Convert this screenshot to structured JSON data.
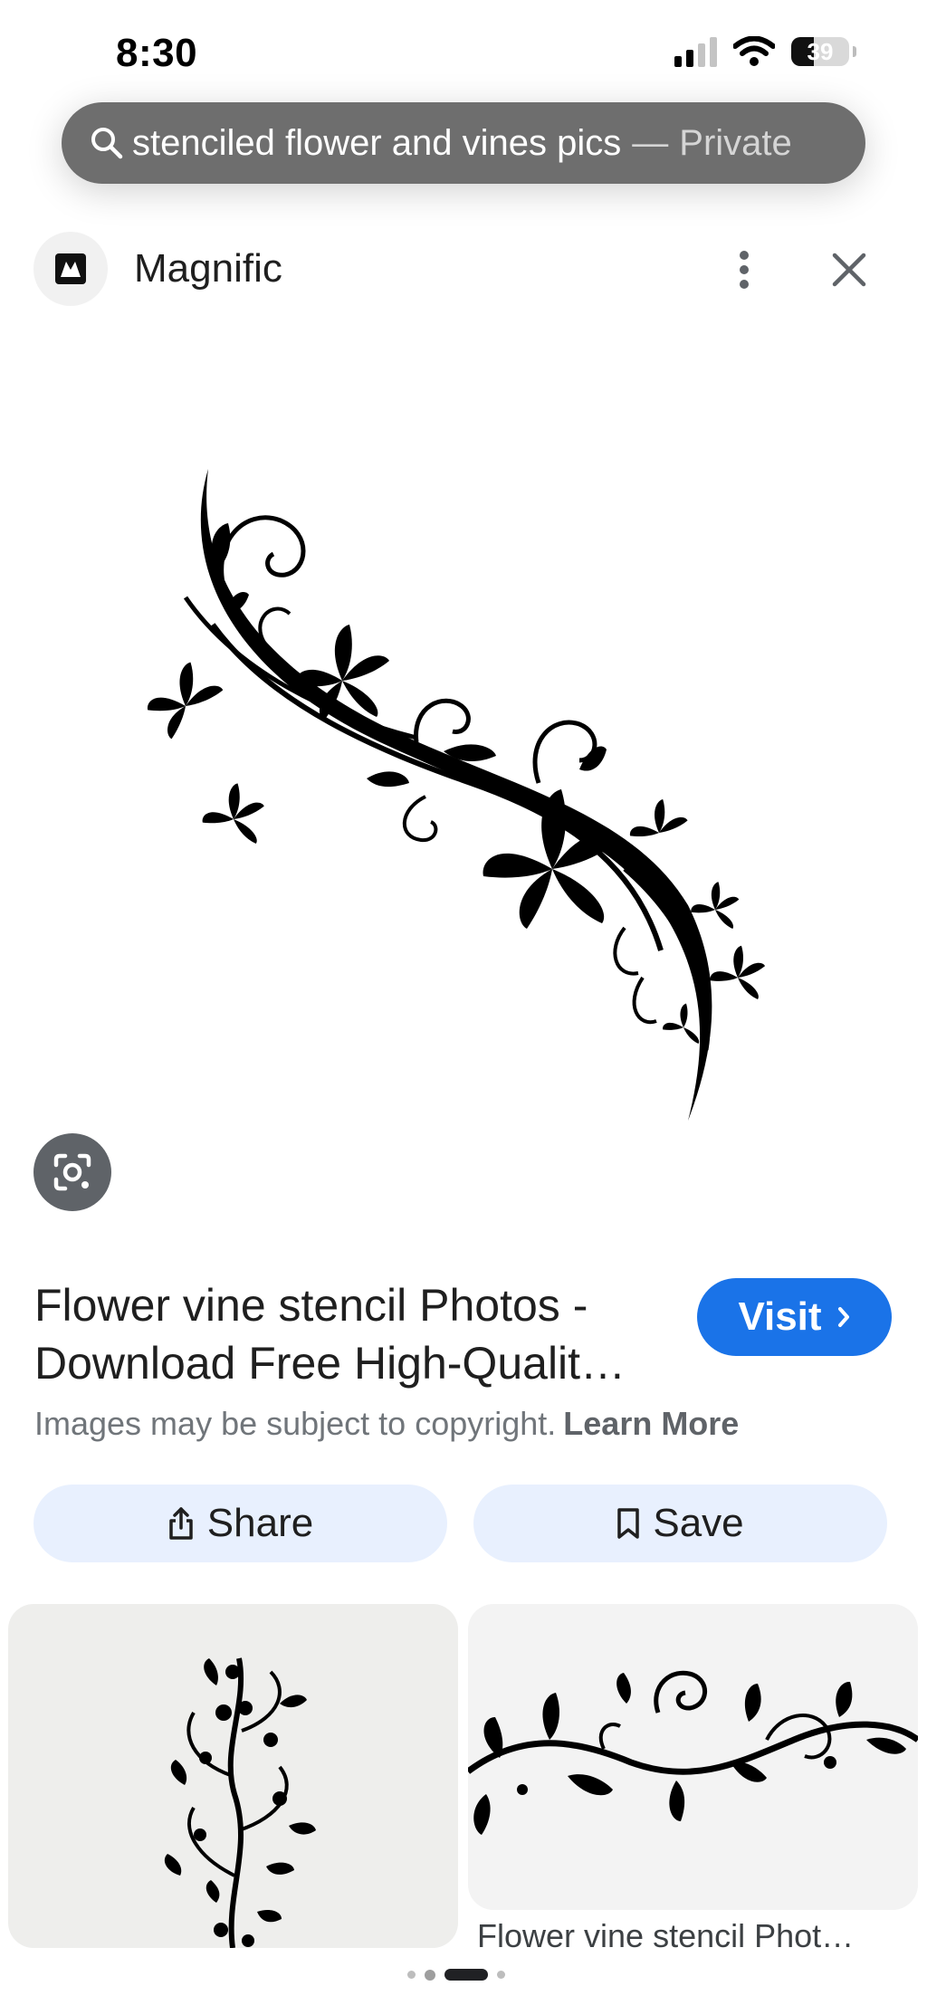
{
  "status_bar": {
    "time": "8:30",
    "battery_percent": "39",
    "battery_level": 0.39
  },
  "search": {
    "query": "stenciled flower and vines pics",
    "separator": "—",
    "mode": "Private"
  },
  "source": {
    "name": "Magnific",
    "icons": {
      "favicon": "magnific-logo",
      "more": "more-vertical-icon",
      "close": "close-icon"
    }
  },
  "result": {
    "title_line1": "Flower vine stencil Photos -",
    "title_line2": "Download Free High-Qualit…",
    "visit_label": "Visit",
    "copyright_text": "Images may be subject to copyright.",
    "learn_more": "Learn More",
    "share_label": "Share",
    "save_label": "Save"
  },
  "related": {
    "items": [
      {
        "caption": ""
      },
      {
        "caption": "Flower vine stencil Phot…"
      }
    ]
  },
  "colors": {
    "accent": "#1a73e8",
    "action_bg": "#e8f0fe",
    "search_pill": "#6e6e6e"
  }
}
